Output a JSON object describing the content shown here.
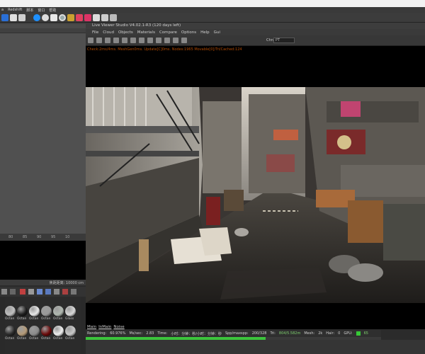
{
  "topmenu": {
    "items": [
      "a",
      "Redshift",
      "脚本",
      "窗口",
      "帮助"
    ]
  },
  "lv": {
    "title": "Live Viewer Studio V4.02.1-R3 (120 days left)",
    "menu": [
      "File",
      "Cloud",
      "Objects",
      "Materials",
      "Compare",
      "Options",
      "Help",
      "Gui"
    ],
    "channel_label": "Chn:",
    "channel_value": "PT",
    "status": "Check:2ms/4ms. MeshGen0ms. Update[C]0ms. Nodes:1965 Movable[0]/Tri/Cached:124"
  },
  "left": {
    "ruler": [
      "80",
      "85",
      "90",
      "95",
      "10"
    ],
    "focal": "焦距距离: 10000 cm",
    "materials": [
      {
        "label": "Octan",
        "color": "#c0c0c0"
      },
      {
        "label": "Octan",
        "color": "#1e1e1e"
      },
      {
        "label": "Octan",
        "color": "#e8e8e8"
      },
      {
        "label": "Octan",
        "color": "#9a9a9a"
      },
      {
        "label": "Octan",
        "color": "#b0b8b0"
      },
      {
        "label": "Glass",
        "color": "#d8d8d8"
      },
      {
        "label": "Octan",
        "color": "#2a2a2a"
      },
      {
        "label": "Octan",
        "color": "#b49a78"
      },
      {
        "label": "Octan",
        "color": "#8a8a8a"
      },
      {
        "label": "Octan",
        "color": "#6a0a0a"
      },
      {
        "label": "Octan",
        "color": "#f0f0f0"
      },
      {
        "label": "Octan",
        "color": "#c8c8c8"
      }
    ]
  },
  "tabs": [
    "Main",
    "InMain",
    "Noise"
  ],
  "stats": {
    "rendering_label": "Rendering:",
    "rendering_pct": "60.976%",
    "ms_label": "Ms/sec:",
    "ms_value": "2.83",
    "time_label": "Time:",
    "time_value": "小时：分钟：秒/小时：分钟：秒",
    "spp_label": "Spp/maxspp:",
    "spp_value": "200/328",
    "tri_label": "Tri:",
    "tri_value": "804/5.582m",
    "mesh_label": "Mesh:",
    "mesh_value": "2k",
    "hair_label": "Hair:",
    "hair_value": "0",
    "gpu_label": "GPU:",
    "gpu_value": "65",
    "progress": 0.61
  },
  "colors": {
    "status_text": "#b34a00",
    "progress": "#3cc43c",
    "accent_red": "#c03050"
  }
}
